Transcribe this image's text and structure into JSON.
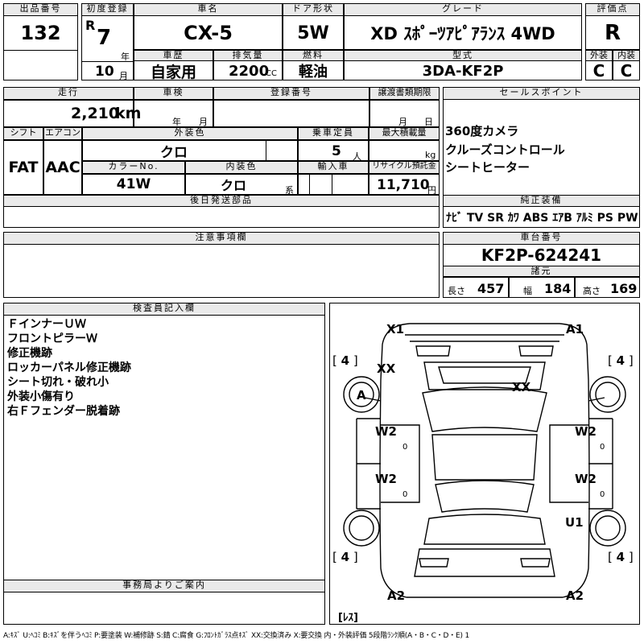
{
  "header": {
    "lot_label": "出品番号",
    "lot_no": "132",
    "first_reg_label": "初度登録",
    "era": "R",
    "year": "7",
    "year_unit": "年",
    "month": "10",
    "month_unit": "月",
    "name_label": "車名",
    "name": "CX-5",
    "door_label": "ドア形状",
    "door": "5W",
    "grade_label": "グレード",
    "grade": "XD ｽﾎﾟｰﾂｱﾋﾟｱﾗﾝｽ 4WD",
    "score_label": "評価点",
    "score": "R",
    "history_label": "車歴",
    "history": "自家用",
    "displacement_label": "排気量",
    "displacement": "2200",
    "displacement_unit": "CC",
    "fuel_label": "燃料",
    "fuel": "軽油",
    "model_label": "型式",
    "model": "3DA-KF2P",
    "ext_grade_label": "外装",
    "ext_grade": "C",
    "int_grade_label": "内装",
    "int_grade": "C"
  },
  "info": {
    "mileage_label": "走行",
    "mileage": "2,210",
    "mileage_unit": "km",
    "inspection_label": "車検",
    "insp_year_unit": "年",
    "insp_month_unit": "月",
    "reg_no_label": "登録番号",
    "transfer_label": "譲渡書類期限",
    "transfer_month_unit": "月",
    "transfer_day_unit": "日",
    "shift_label": "シフト",
    "shift": "FAT",
    "ac_label": "エアコン",
    "ac": "AAC",
    "ext_color_label": "外装色",
    "ext_color": "クロ",
    "capacity_label": "乗車定員",
    "capacity": "5",
    "capacity_unit": "人",
    "load_label": "最大積載量",
    "load_unit": "kg",
    "color_no_label": "カラーNo.",
    "color_no": "41W",
    "int_color_label": "内装色",
    "int_color": "クロ",
    "int_color_unit": "系",
    "import_label": "輸入車",
    "recycle_label": "リサイクル預託金",
    "recycle": "11,710",
    "recycle_unit": "円",
    "later_parts_label": "後日発送部品"
  },
  "sales": {
    "label": "セールスポイント",
    "points": [
      "360度カメラ",
      "クルーズコントロール",
      "シートヒーター"
    ]
  },
  "equipment": {
    "label": "純正装備",
    "items": [
      "ﾅﾋﾞ",
      "TV",
      "SR",
      "ｶﾜ",
      "ABS",
      "ｴｱB",
      "ｱﾙﾐ",
      "PS",
      "PW"
    ]
  },
  "notes": {
    "label": "注意事項欄"
  },
  "chassis": {
    "label": "車台番号",
    "number": "KF2P-624241",
    "dims_label": "諸元",
    "length_label": "長さ",
    "length": "457",
    "width_label": "幅",
    "width": "184",
    "height_label": "高さ",
    "height": "169"
  },
  "inspector": {
    "label": "検査員記入欄",
    "lines": [
      "ＦインナーＵＷ",
      "フロントピラーＷ",
      "修正機跡",
      "ロッカーパネル修正機跡",
      "シート切れ・破れ小",
      "外装小傷有り",
      "右Ｆフェンダー脱着跡"
    ]
  },
  "diagram": {
    "marks": {
      "x1": "X1",
      "a1": "A1",
      "xx_left": "XX",
      "xx_center": "XX",
      "a": "A",
      "w2_fl": "W2",
      "w2_fr": "W2",
      "w2_rl": "W2",
      "w2_rr": "W2",
      "u1": "U1",
      "a2_l": "A2",
      "a2_r": "A2"
    },
    "tires": {
      "fl": "4",
      "fr": "4",
      "rl": "4",
      "rr": "4"
    },
    "tire_bracket_open": "[",
    "tire_bracket_close": "]",
    "zero": "0",
    "spare": "[ﾚｽ]"
  },
  "office": {
    "label": "事務局よりご案内"
  },
  "legend": "A:ｷｽﾞ U:ﾍｺﾐ B:ｷｽﾞを伴うﾍｺﾐ P:要塗装 W:補修跡 S:錆 C:腐食 G:ﾌﾛﾝﾄｶﾞﾗｽ点ｷｽﾞ XX:交換済み X:要交換 内・外装評価 5段階ﾗﾝｸ順(A・B・C・D・E) 1"
}
